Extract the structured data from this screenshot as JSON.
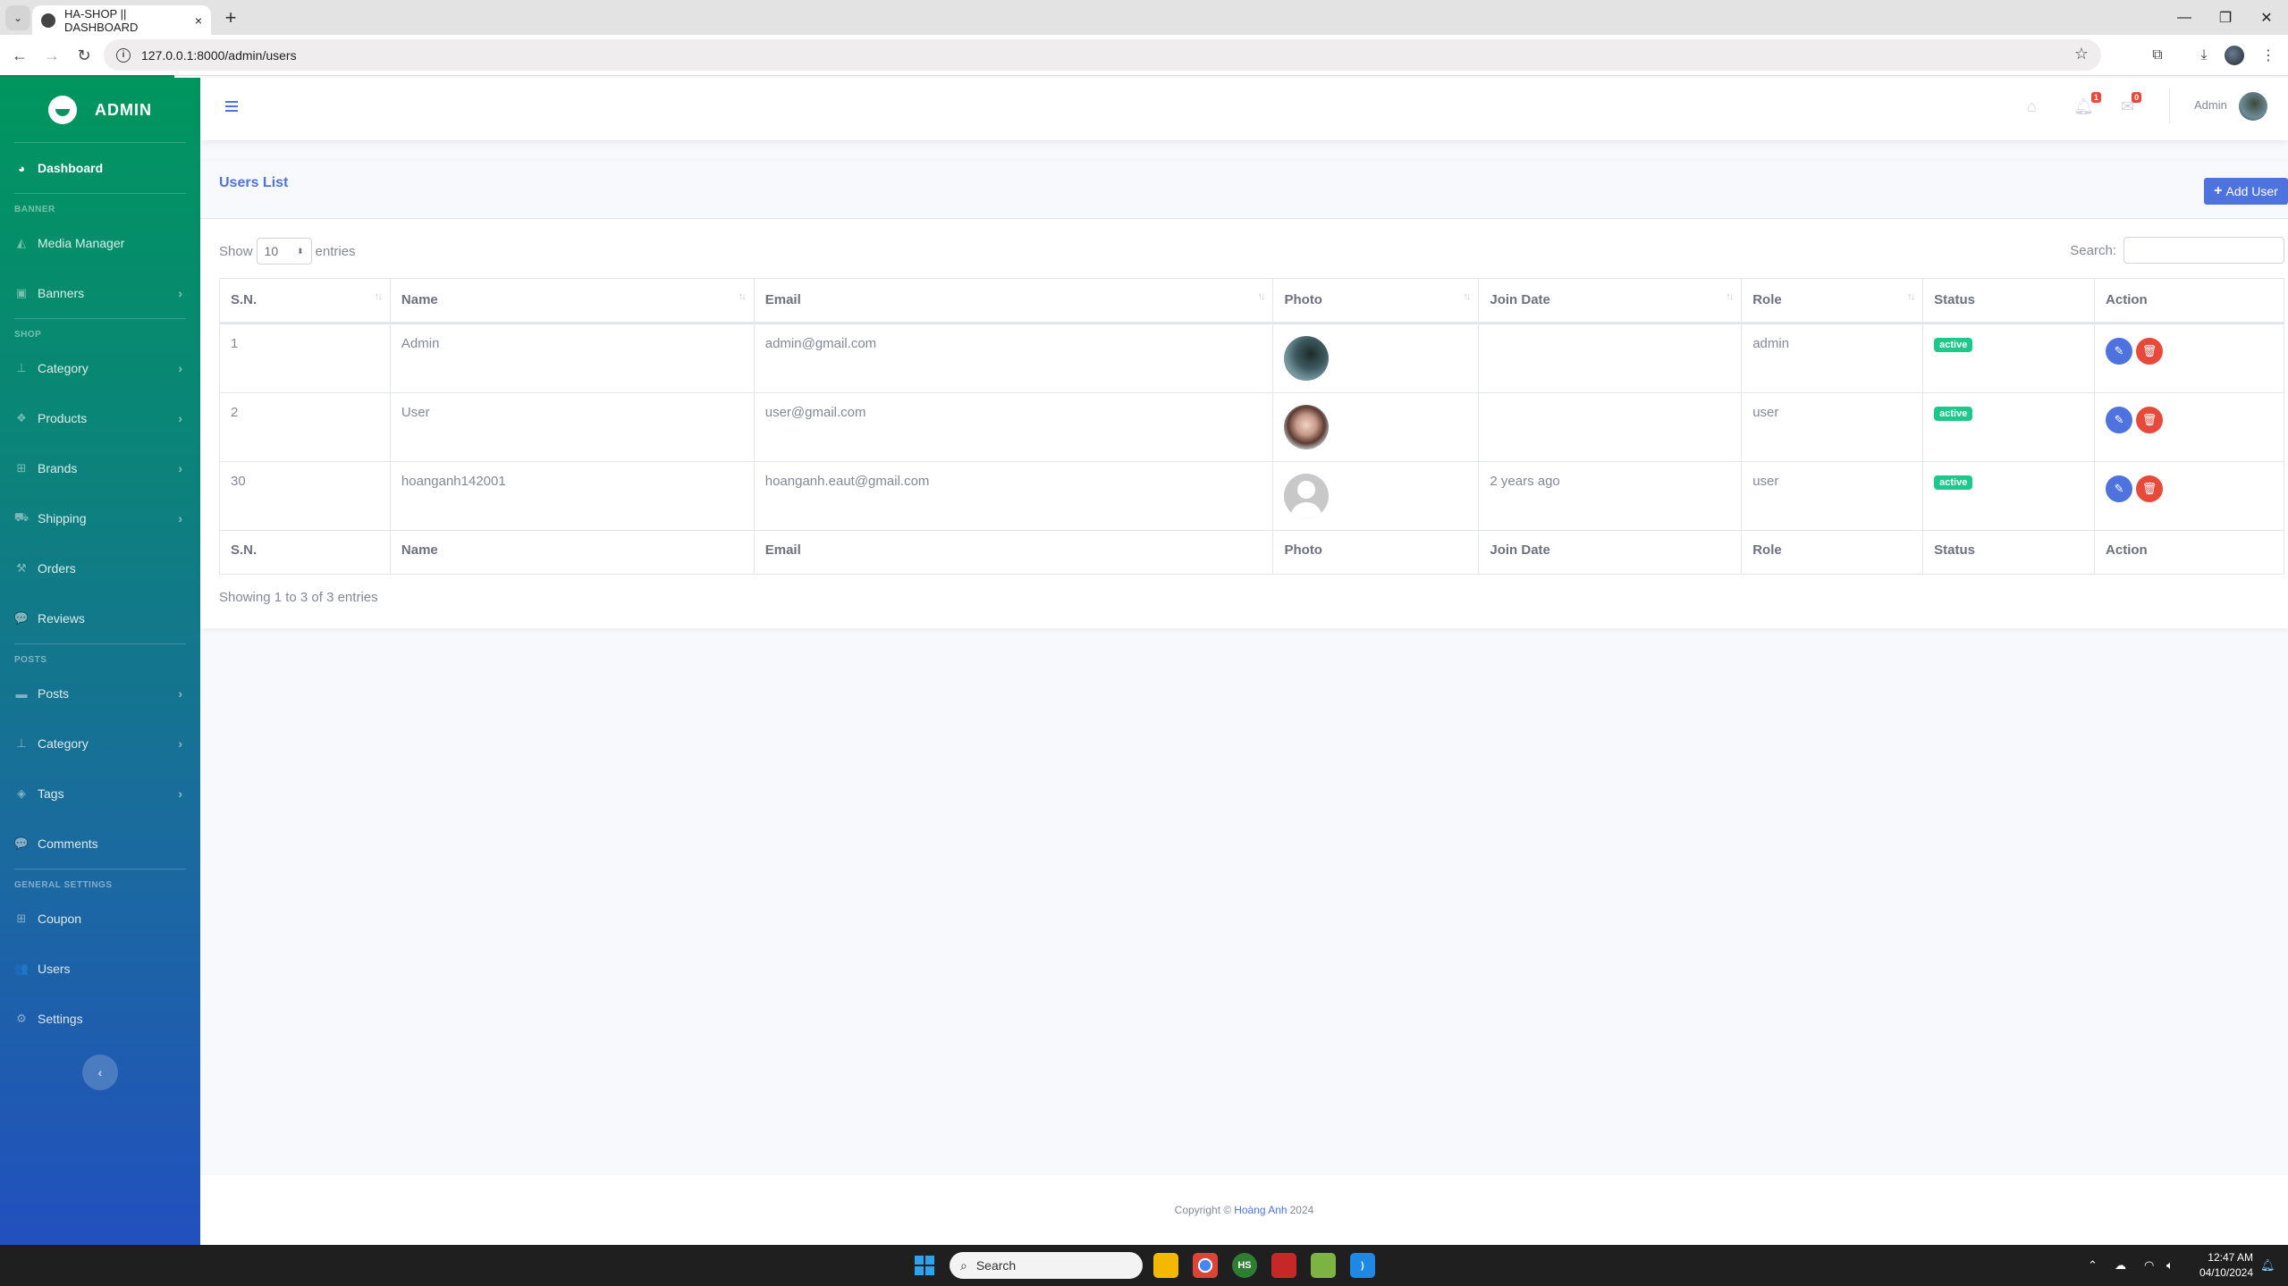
{
  "browser": {
    "tab_title": "HA-SHOP || DASHBOARD",
    "url": "127.0.0.1:8000/admin/users",
    "new_tab": "+",
    "tab_close": "×"
  },
  "sidebar": {
    "brand": "ADMIN",
    "dashboard": "Dashboard",
    "sections": {
      "banner": "BANNER",
      "shop": "SHOP",
      "posts": "POSTS",
      "general": "GENERAL SETTINGS"
    },
    "items": {
      "media_manager": "Media Manager",
      "banners": "Banners",
      "category": "Category",
      "products": "Products",
      "brands": "Brands",
      "shipping": "Shipping",
      "orders": "Orders",
      "reviews": "Reviews",
      "posts": "Posts",
      "post_category": "Category",
      "tags": "Tags",
      "comments": "Comments",
      "coupon": "Coupon",
      "users": "Users",
      "settings": "Settings"
    }
  },
  "topbar": {
    "notifications_count": "1",
    "messages_count": "0",
    "user_name": "Admin"
  },
  "card": {
    "title": "Users List",
    "add_button": "Add User",
    "show_label": "Show",
    "entries_label": "entries",
    "page_length": "10",
    "search_label": "Search:",
    "search_value": "",
    "info": "Showing 1 to 3 of 3 entries"
  },
  "table": {
    "columns": [
      "S.N.",
      "Name",
      "Email",
      "Photo",
      "Join Date",
      "Role",
      "Status",
      "Action"
    ],
    "rows": [
      {
        "sn": "1",
        "name": "Admin",
        "email": "admin@gmail.com",
        "photo": "admin-avatar",
        "join_date": "",
        "role": "admin",
        "status": "active"
      },
      {
        "sn": "2",
        "name": "User",
        "email": "user@gmail.com",
        "photo": "user-avatar",
        "join_date": "",
        "role": "user",
        "status": "active"
      },
      {
        "sn": "30",
        "name": "hoanganh142001",
        "email": "hoanganh.eaut@gmail.com",
        "photo": "default-avatar",
        "join_date": "2 years ago",
        "role": "user",
        "status": "active"
      }
    ]
  },
  "footer": {
    "prefix": "Copyright ©",
    "author": "Hoàng Anh",
    "year": "2024"
  },
  "taskbar": {
    "search_placeholder": "Search",
    "time": "12:47 AM",
    "date": "04/10/2024"
  },
  "colors": {
    "primary": "#4e73df",
    "success": "#1cc88a",
    "danger": "#e74a3b",
    "sidebar_top": "#00965e",
    "sidebar_bottom": "#2250be"
  }
}
